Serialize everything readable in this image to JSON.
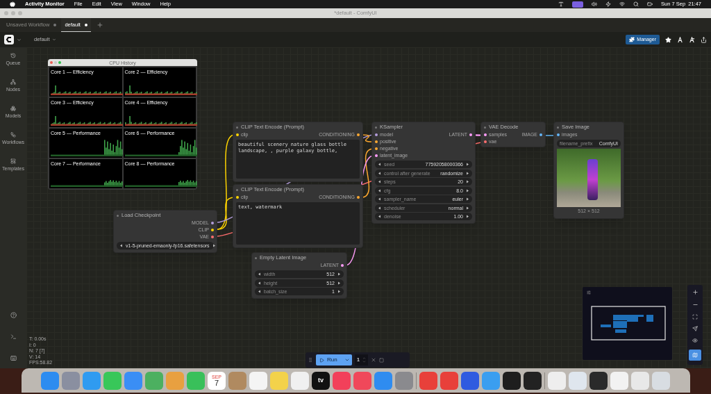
{
  "menu_bar": {
    "app": "Activity Monitor",
    "menus": [
      "File",
      "Edit",
      "View",
      "Window",
      "Help"
    ],
    "clock": "Sun 7 Sep  21:47"
  },
  "window": {
    "title": "*default - ComfyUI"
  },
  "tabs": [
    {
      "label": "Unsaved Workflow",
      "selected": false
    },
    {
      "label": "default",
      "selected": true
    }
  ],
  "toolbar": {
    "workflow": "default",
    "manager": "Manager"
  },
  "sidebar": {
    "items": [
      {
        "label": "Queue"
      },
      {
        "label": "Nodes"
      },
      {
        "label": "Models"
      },
      {
        "label": "Workflows"
      },
      {
        "label": "Templates"
      }
    ]
  },
  "cpu_history": {
    "title": "CPU History",
    "cores": [
      "Core 1 — Efficiency",
      "Core 2 — Efficiency",
      "Core 3 — Efficiency",
      "Core 4 — Efficiency",
      "Core 5 — Performance",
      "Core 6 — Performance",
      "Core 7 — Performance",
      "Core 8 — Performance"
    ]
  },
  "nodes": [
    {
      "title": "CLIP Text Encode (Prompt)",
      "inputs": [
        {
          "label": "clip",
          "color": "#ffd500"
        }
      ],
      "outputs": [
        {
          "label": "CONDITIONING",
          "color": "#ffa931"
        }
      ],
      "text": "beautiful scenery nature glass bottle landscape, , purple galaxy bottle,"
    },
    {
      "title": "CLIP Text Encode (Prompt)",
      "inputs": [
        {
          "label": "clip",
          "color": "#ffd500"
        }
      ],
      "outputs": [
        {
          "label": "CONDITIONING",
          "color": "#ffa931"
        }
      ],
      "text": "text, watermark"
    },
    {
      "title": "Load Checkpoint",
      "outputs": [
        {
          "label": "MODEL",
          "color": "#b39ddb"
        },
        {
          "label": "CLIP",
          "color": "#ffd500"
        },
        {
          "label": "VAE",
          "color": "#ff6e6e"
        }
      ],
      "widgets": [
        {
          "kind": "combo",
          "value": "v1-5-pruned-emaonly-fp16.safetensors"
        }
      ]
    },
    {
      "title": "Empty Latent Image",
      "outputs": [
        {
          "label": "LATENT",
          "color": "#ff9cf9"
        }
      ],
      "widgets": [
        {
          "kind": "number",
          "label": "width",
          "value": "512"
        },
        {
          "kind": "number",
          "label": "height",
          "value": "512"
        },
        {
          "kind": "number",
          "label": "batch_size",
          "value": "1"
        }
      ]
    },
    {
      "title": "KSampler",
      "inputs": [
        {
          "label": "model",
          "color": "#b39ddb"
        },
        {
          "label": "positive",
          "color": "#ffa931"
        },
        {
          "label": "negative",
          "color": "#ffa931"
        },
        {
          "label": "latent_image",
          "color": "#ff9cf9"
        }
      ],
      "outputs": [
        {
          "label": "LATENT",
          "color": "#ff9cf9"
        }
      ],
      "widgets": [
        {
          "kind": "number",
          "label": "seed",
          "value": "77592058000366"
        },
        {
          "kind": "combo",
          "label": "control after generate",
          "value": "randomize"
        },
        {
          "kind": "number",
          "label": "steps",
          "value": "20"
        },
        {
          "kind": "number",
          "label": "cfg",
          "value": "8.0"
        },
        {
          "kind": "combo",
          "label": "sampler_name",
          "value": "euler"
        },
        {
          "kind": "combo",
          "label": "scheduler",
          "value": "normal"
        },
        {
          "kind": "number",
          "label": "denoise",
          "value": "1.00"
        }
      ]
    },
    {
      "title": "VAE Decode",
      "inputs": [
        {
          "label": "samples",
          "color": "#ff9cf9"
        },
        {
          "label": "vae",
          "color": "#ff6e6e"
        }
      ],
      "outputs": [
        {
          "label": "IMAGE",
          "color": "#64b5f6"
        }
      ]
    },
    {
      "title": "Save Image",
      "inputs": [
        {
          "label": "images",
          "color": "#64b5f6"
        }
      ],
      "widgets": [
        {
          "kind": "text",
          "label": "filename_prefix",
          "value": "ComfyUI"
        }
      ],
      "image": {
        "caption": "512 × 512"
      }
    }
  ],
  "stats": [
    "T: 0.00s",
    "I: 0",
    "N: 7 [7]",
    "V: 14",
    "FPS:58.82"
  ],
  "run_bar": {
    "run": "Run",
    "count": "1"
  },
  "minimap": {
    "on": true
  },
  "dock": {
    "calendar_month": "SEP",
    "calendar_day": "7",
    "tv": "tv"
  }
}
